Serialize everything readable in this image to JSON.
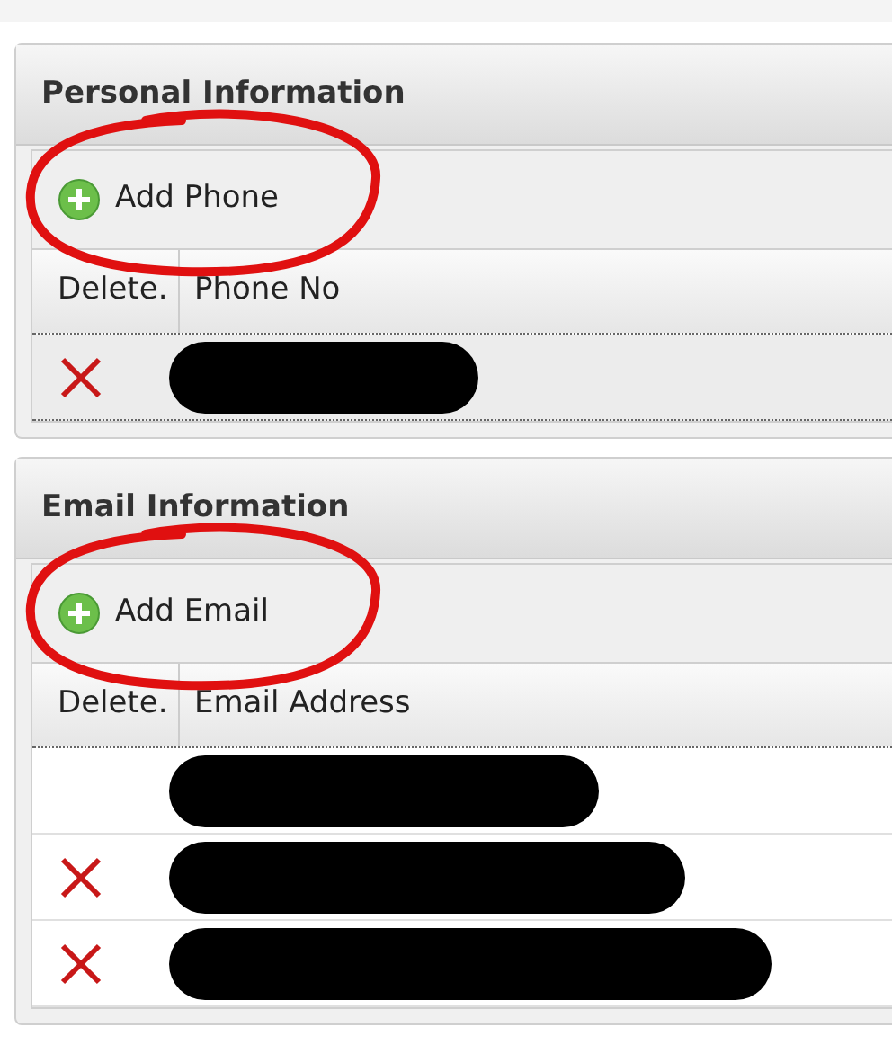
{
  "sections": [
    {
      "title": "Personal Information",
      "add_button": {
        "label": "Add Phone",
        "annotated": true
      },
      "columns": [
        "Delete.",
        "Phone No"
      ],
      "rows": [
        {
          "deletable": true,
          "redacted": true
        }
      ]
    },
    {
      "title": "Email Information",
      "add_button": {
        "label": "Add Email",
        "annotated": true
      },
      "columns": [
        "Delete.",
        "Email Address"
      ],
      "rows": [
        {
          "deletable": false,
          "redacted": true
        },
        {
          "deletable": true,
          "redacted": true
        },
        {
          "deletable": true,
          "redacted": true
        }
      ]
    }
  ]
}
